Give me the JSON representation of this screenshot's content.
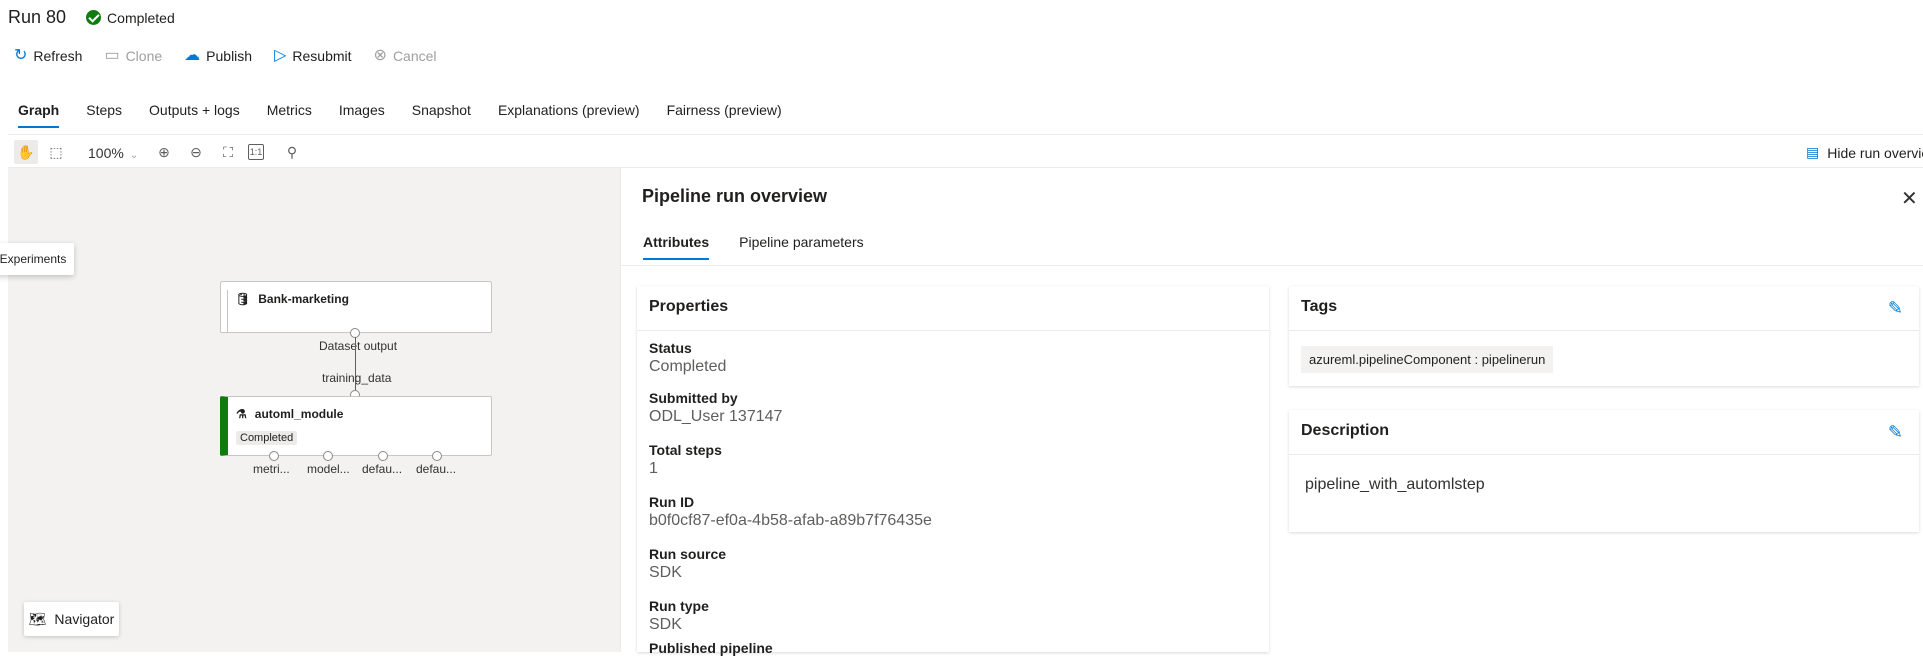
{
  "header": {
    "title": "Run 80",
    "status": "Completed",
    "status_color": "#107c10"
  },
  "commands": [
    {
      "label": "Refresh",
      "icon": "refresh-icon",
      "enabled": true
    },
    {
      "label": "Clone",
      "icon": "clone-icon",
      "enabled": false
    },
    {
      "label": "Publish",
      "icon": "cloud-upload-icon",
      "enabled": true
    },
    {
      "label": "Resubmit",
      "icon": "play-icon",
      "enabled": true
    },
    {
      "label": "Cancel",
      "icon": "cancel-icon",
      "enabled": false
    }
  ],
  "tabs": [
    "Graph",
    "Steps",
    "Outputs + logs",
    "Metrics",
    "Images",
    "Snapshot",
    "Explanations (preview)",
    "Fairness (preview)"
  ],
  "active_tab": "Graph",
  "graph_toolbar": {
    "zoom": "100%",
    "actual_size_label": "1:1",
    "hide_run_overview": "Hide run overview"
  },
  "canvas": {
    "tooltip": "Experiments",
    "node_dataset": {
      "title": "Bank-marketing",
      "output_label": "Dataset output"
    },
    "edge_label": "training_data",
    "node_module": {
      "title": "automl_module",
      "status": "Completed",
      "outputs": [
        "metri...",
        "model...",
        "defau...",
        "defau..."
      ]
    },
    "navigator": "Navigator"
  },
  "panel": {
    "title": "Pipeline run overview",
    "tabs": [
      "Attributes",
      "Pipeline parameters"
    ],
    "active_tab": "Attributes",
    "properties": {
      "heading": "Properties",
      "items": [
        {
          "label": "Status",
          "value": "Completed"
        },
        {
          "label": "Submitted by",
          "value": "ODL_User 137147"
        },
        {
          "label": "Total steps",
          "value": "1"
        },
        {
          "label": "Run ID",
          "value": "b0f0cf87-ef0a-4b58-afab-a89b7f76435e"
        },
        {
          "label": "Run source",
          "value": "SDK"
        },
        {
          "label": "Run type",
          "value": "SDK"
        },
        {
          "label": "Published pipeline",
          "value": ""
        }
      ]
    },
    "tags": {
      "heading": "Tags",
      "items": [
        "azureml.pipelineComponent : pipelinerun"
      ]
    },
    "description": {
      "heading": "Description",
      "text": "pipeline_with_automlstep"
    }
  },
  "accent_color": "#0078d4"
}
